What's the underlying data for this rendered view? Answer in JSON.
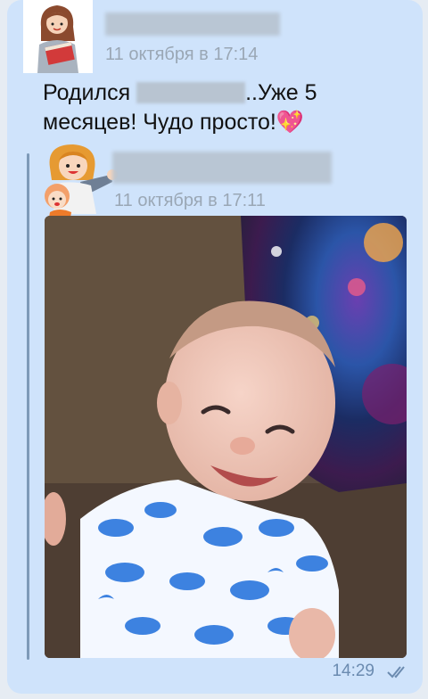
{
  "message": {
    "timestamp": "11 октября в 17:14",
    "text_before": "Родился",
    "text_after": "..Уже 5 месяцев! Чудо просто!",
    "emoji": "💖"
  },
  "quoted": {
    "timestamp": "11 октября в 17:11"
  },
  "footer": {
    "time": "14:29"
  },
  "icons": {
    "read_status": "double-check-icon",
    "sparkle_heart": "sparkling-heart-icon"
  },
  "colors": {
    "bubble": "#cfe3fb",
    "quote_bar": "#7e9ab8",
    "meta_text": "#9aa7b5",
    "time_text": "#6b8bb0"
  }
}
